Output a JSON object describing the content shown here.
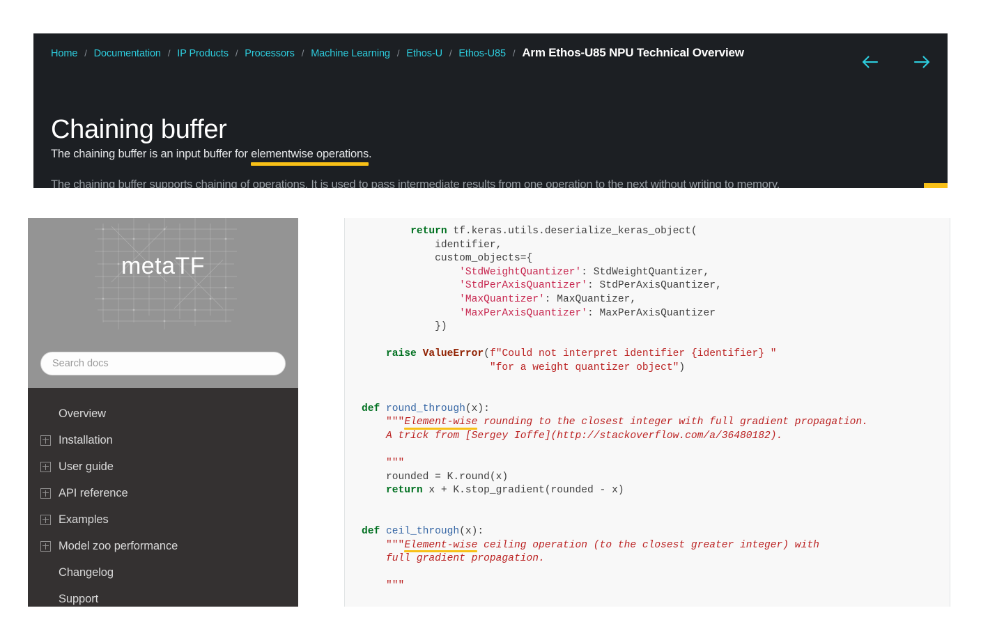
{
  "arm_doc": {
    "breadcrumb": [
      {
        "label": "Home",
        "current": false
      },
      {
        "label": "Documentation",
        "current": false
      },
      {
        "label": "IP Products",
        "current": false
      },
      {
        "label": "Processors",
        "current": false
      },
      {
        "label": "Machine Learning",
        "current": false
      },
      {
        "label": "Ethos-U",
        "current": false
      },
      {
        "label": "Ethos-U85",
        "current": false
      },
      {
        "label": "Arm Ethos-U85 NPU Technical Overview",
        "current": true
      }
    ],
    "separator": "/",
    "nav": {
      "back_icon": "arrow-left-icon",
      "forward_icon": "arrow-right-icon"
    },
    "title": "Chaining buffer",
    "subtitle_pre": "The chaining buffer is an input buffer for ",
    "subtitle_highlight": "elementwise operations",
    "subtitle_post": ".",
    "clipped_body_line": "The chaining buffer supports chaining of operations. It is used to pass intermediate results from one operation to the next without writing to memory.",
    "colors": {
      "panel_bg": "#1c1f23",
      "link": "#2dccdd",
      "highlight": "#f8c017",
      "title": "#ffffff"
    }
  },
  "metatf_doc": {
    "sidebar": {
      "logo_text": "metaTF",
      "search": {
        "placeholder": "Search docs",
        "value": ""
      },
      "items": [
        {
          "label": "Overview",
          "expandable": false
        },
        {
          "label": "Installation",
          "expandable": true
        },
        {
          "label": "User guide",
          "expandable": true
        },
        {
          "label": "API reference",
          "expandable": true
        },
        {
          "label": "Examples",
          "expandable": true
        },
        {
          "label": "Model zoo performance",
          "expandable": true
        },
        {
          "label": "Changelog",
          "expandable": false
        },
        {
          "label": "Support",
          "expandable": false
        }
      ],
      "colors": {
        "nav_bg": "#343131",
        "logo_bg": "#949494",
        "nav_text": "#d9d9d9"
      }
    },
    "code": {
      "language": "python",
      "background": "#f8f8f8",
      "lines": [
        "        return tf.keras.utils.deserialize_keras_object(",
        "            identifier,",
        "            custom_objects={",
        "                'StdWeightQuantizer': StdWeightQuantizer,",
        "                'StdPerAxisQuantizer': StdPerAxisQuantizer,",
        "                'MaxQuantizer': MaxQuantizer,",
        "                'MaxPerAxisQuantizer': MaxPerAxisQuantizer",
        "            })",
        "",
        "    raise ValueError(f\"Could not interpret identifier {identifier} \"",
        "                     \"for a weight quantizer object\")",
        "",
        "",
        "def round_through(x):",
        "    \"\"\"Element-wise rounding to the closest integer with full gradient propagation.",
        "    A trick from [Sergey Ioffe](http://stackoverflow.com/a/36480182).",
        "",
        "    \"\"\"",
        "    rounded = K.round(x)",
        "    return x + K.stop_gradient(rounded - x)",
        "",
        "",
        "def ceil_through(x):",
        "    \"\"\"Element-wise ceiling operation (to the closest greater integer) with",
        "    full gradient propagation.",
        "",
        "    \"\"\""
      ],
      "highlighted_terms": [
        "Element-wise",
        "Element-wise"
      ],
      "keyword_color": "#007020",
      "string_color": "#bb2222",
      "function_color": "#3465a4",
      "exception_color": "#902000"
    }
  }
}
